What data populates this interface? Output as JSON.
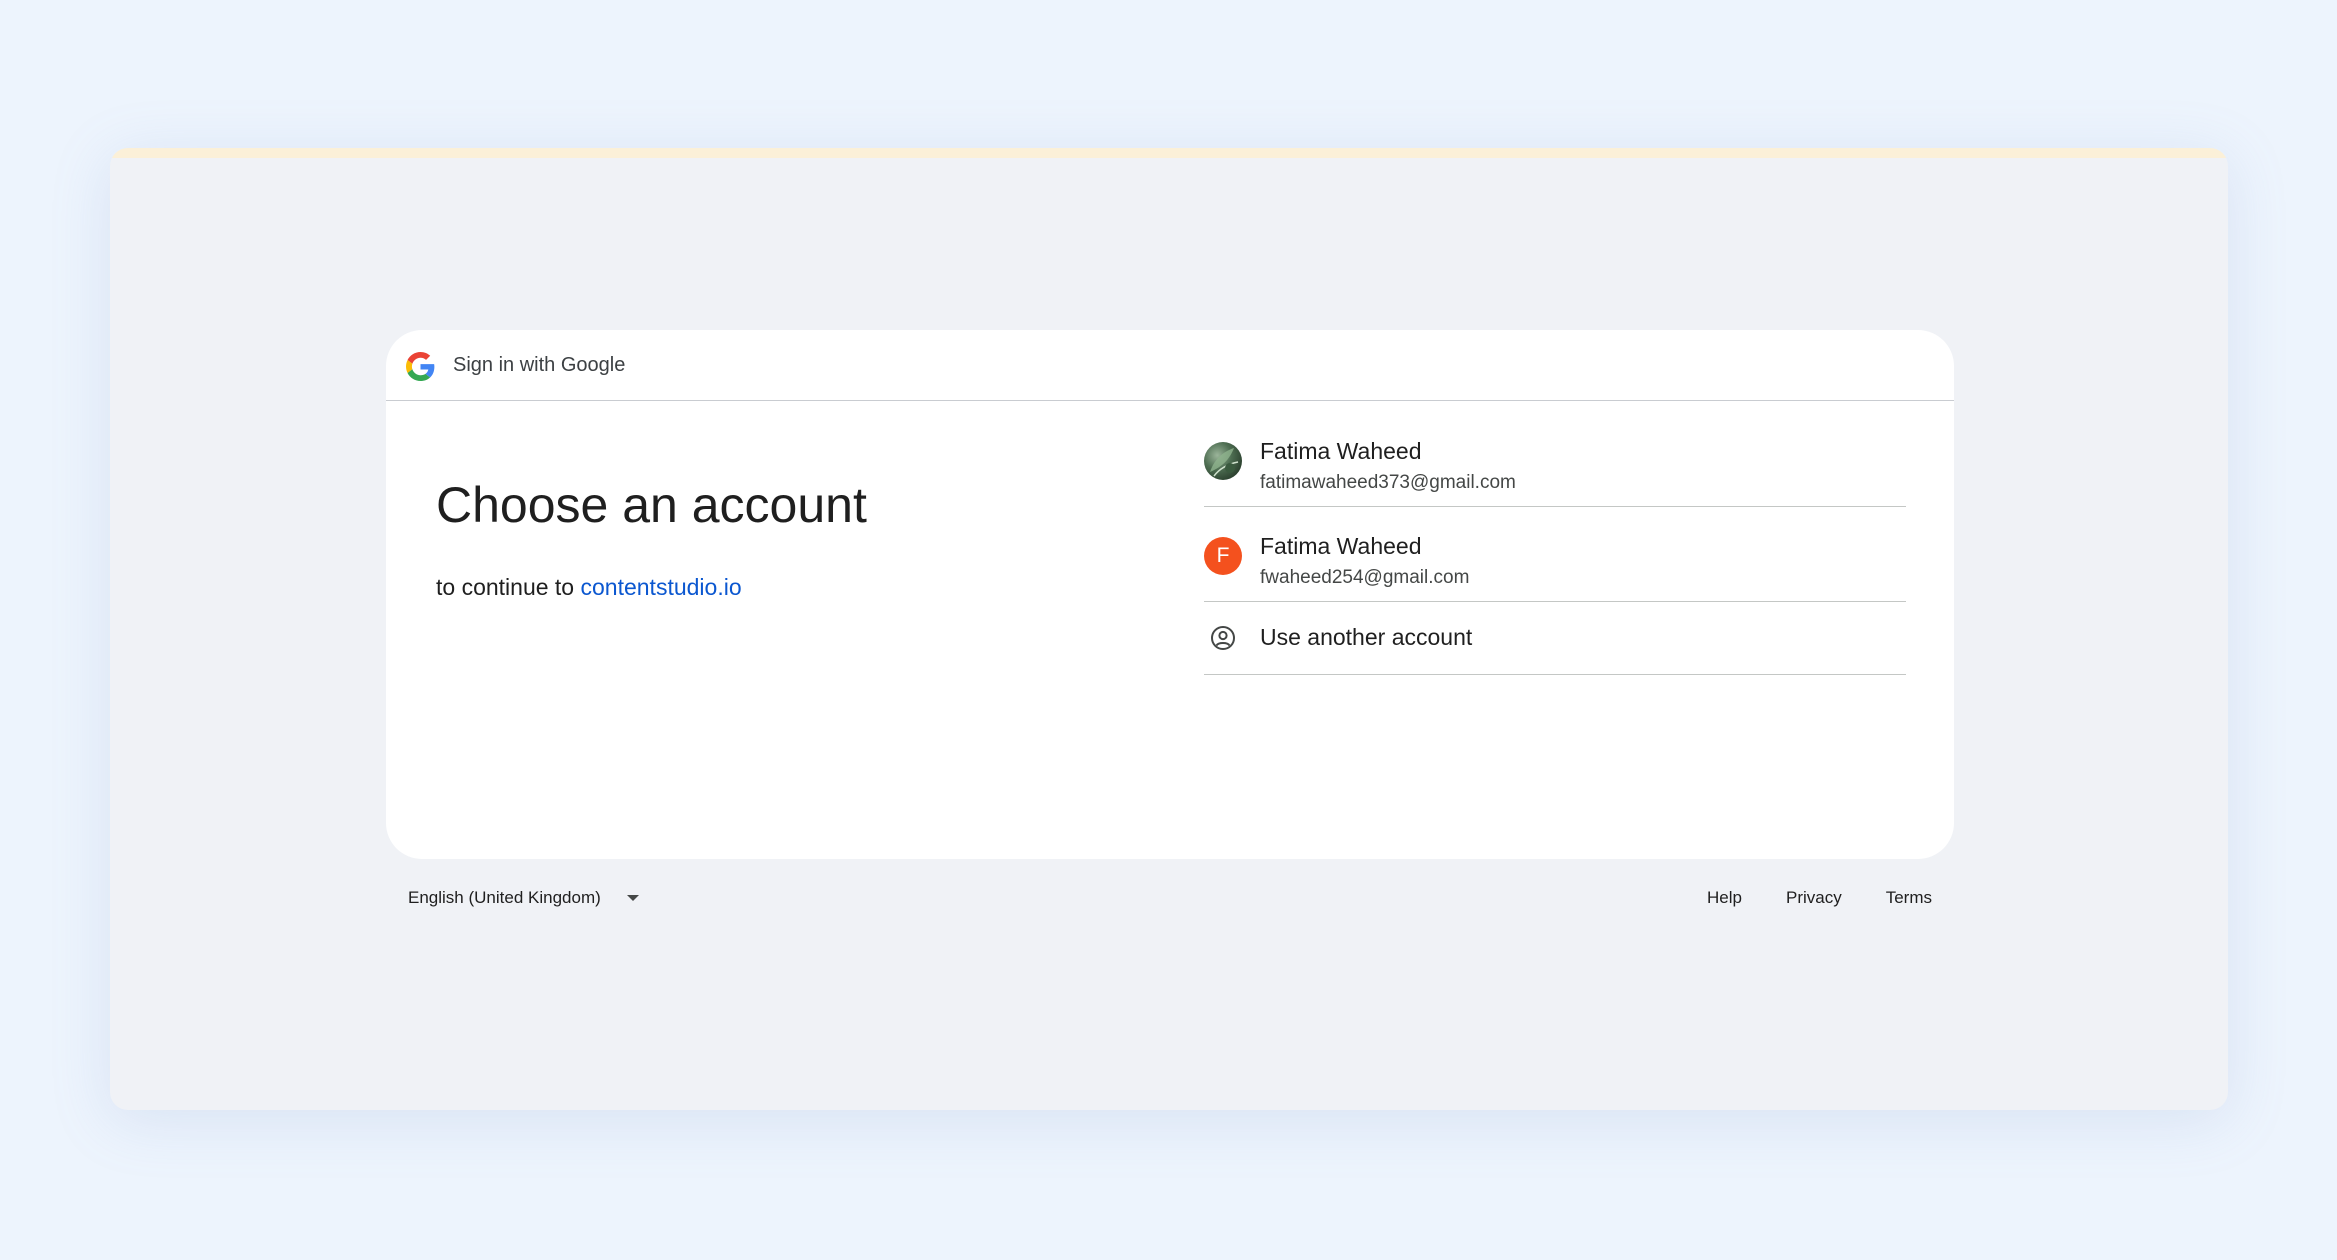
{
  "header": {
    "title": "Sign in with Google"
  },
  "main": {
    "heading": "Choose an account",
    "subtitle_prefix": "to continue to",
    "subtitle_link": "contentstudio.io"
  },
  "accounts": [
    {
      "name": "Fatima Waheed",
      "email": "fatimawaheed373@gmail.com",
      "avatar": "photo"
    },
    {
      "name": "Fatima Waheed",
      "email": "fwaheed254@gmail.com",
      "avatar_letter": "F",
      "avatar_color": "#f4511e"
    }
  ],
  "use_another": {
    "label": "Use another account",
    "icon": "account-circle-icon"
  },
  "footer": {
    "language": "English (United Kingdom)",
    "links": {
      "help": "Help",
      "privacy": "Privacy",
      "terms": "Terms"
    }
  },
  "colors": {
    "link": "#0b57d0",
    "window_bg": "#f0f2f6",
    "page_bg": "#edf4fd"
  }
}
